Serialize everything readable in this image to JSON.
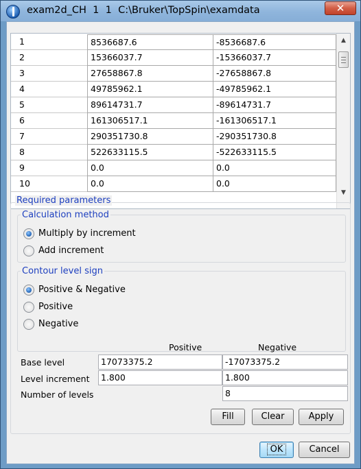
{
  "window": {
    "title": "exam2d_CH  1  1  C:\\Bruker\\TopSpin\\examdata",
    "close_glyph": "✕"
  },
  "table": {
    "rows": [
      {
        "index": "1",
        "positive": "8536687.6",
        "negative": "-8536687.6"
      },
      {
        "index": "2",
        "positive": "15366037.7",
        "negative": "-15366037.7"
      },
      {
        "index": "3",
        "positive": "27658867.8",
        "negative": "-27658867.8"
      },
      {
        "index": "4",
        "positive": "49785962.1",
        "negative": "-49785962.1"
      },
      {
        "index": "5",
        "positive": "89614731.7",
        "negative": "-89614731.7"
      },
      {
        "index": "6",
        "positive": "161306517.1",
        "negative": "-161306517.1"
      },
      {
        "index": "7",
        "positive": "290351730.8",
        "negative": "-290351730.8"
      },
      {
        "index": "8",
        "positive": "522633115.5",
        "negative": "-522633115.5"
      },
      {
        "index": "9",
        "positive": "0.0",
        "negative": "0.0"
      },
      {
        "index": "10",
        "positive": "0.0",
        "negative": "0.0"
      }
    ],
    "scroll_up_glyph": "▲",
    "scroll_down_glyph": "▼"
  },
  "required": {
    "legend": "Required parameters",
    "calc_method": {
      "legend": "Calculation method",
      "options": [
        "Multiply by increment",
        "Add increment"
      ],
      "selected": 0
    },
    "sign": {
      "legend": "Contour level sign",
      "options": [
        "Positive & Negative",
        "Positive",
        "Negative"
      ],
      "selected": 0
    },
    "levels": {
      "col_positive": "Positive",
      "col_negative": "Negative",
      "base_level_label": "Base level",
      "base_level_pos": "17073375.2",
      "base_level_neg": "-17073375.2",
      "increment_label": "Level increment",
      "increment_pos": "1.800",
      "increment_neg": "1.800",
      "num_levels_label": "Number of levels",
      "num_levels": "8"
    },
    "buttons": {
      "fill": "Fill",
      "clear": "Clear",
      "apply": "Apply"
    }
  },
  "footer": {
    "ok": "OK",
    "cancel": "Cancel"
  },
  "colors": {
    "legend_text": "#1d3fbf",
    "title_bar": "#8fb5dc",
    "close_button": "#c0422a"
  }
}
